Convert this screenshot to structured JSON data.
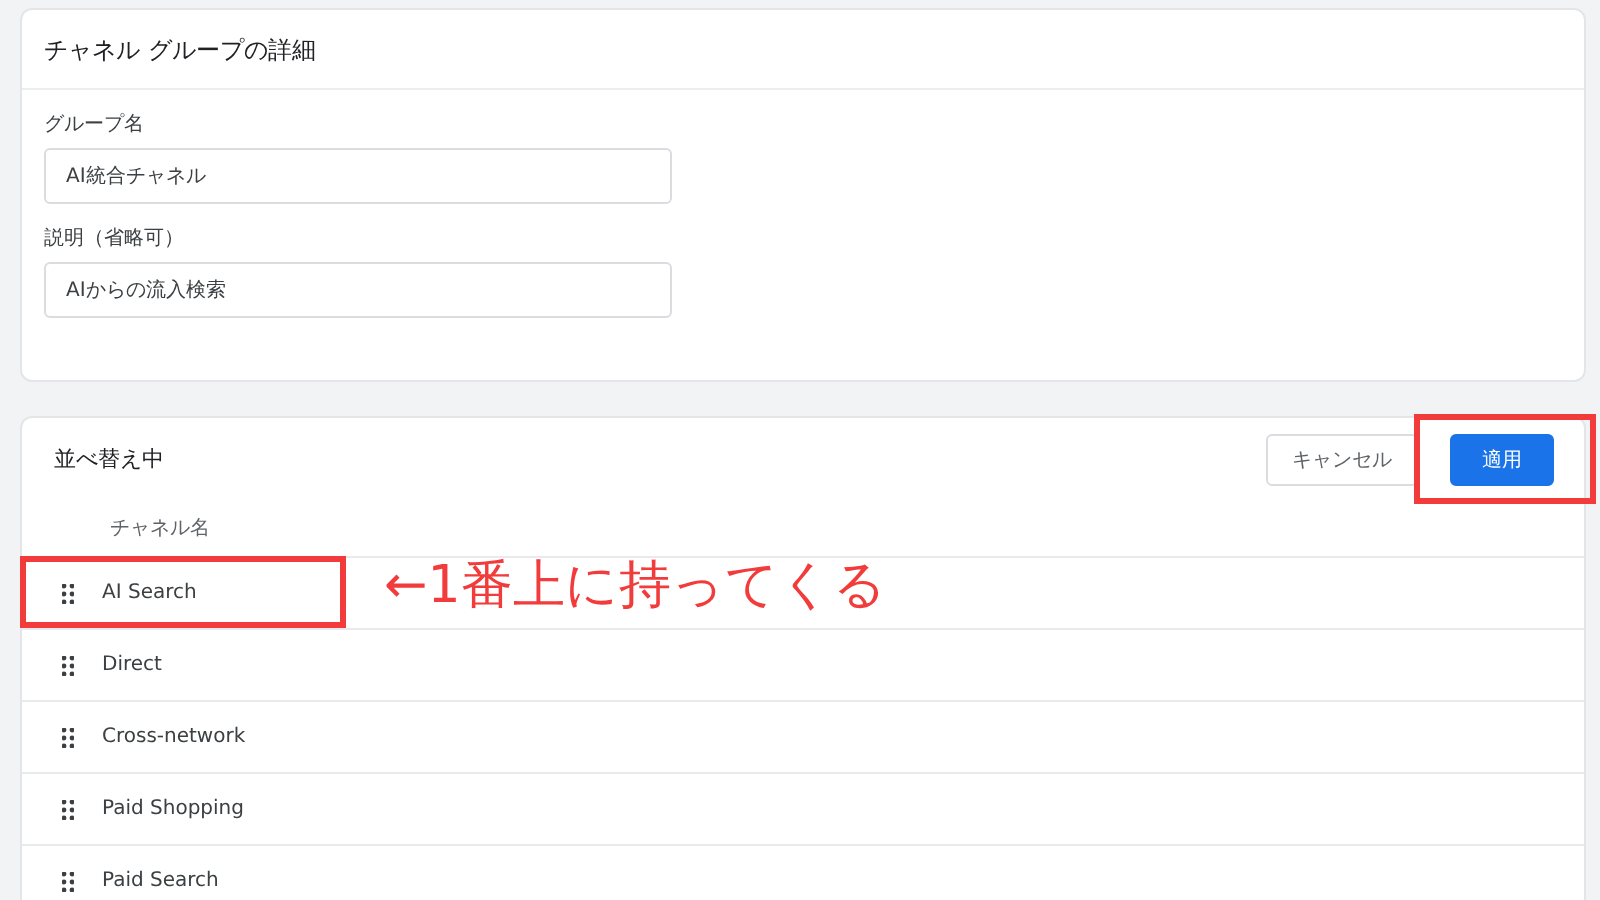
{
  "details_card": {
    "title": "チャネル グループの詳細",
    "fields": [
      {
        "label": "グループ名",
        "value": "AI統合チャネル"
      },
      {
        "label": "説明（省略可）",
        "value": "AIからの流入検索"
      }
    ]
  },
  "reorder_card": {
    "title": "並べ替え中",
    "buttons": [
      {
        "label": "キャンセル",
        "kind": "secondary"
      },
      {
        "label": "適用",
        "kind": "primary"
      }
    ],
    "column_header": "チャネル名",
    "rows": [
      {
        "name": "AI Search"
      },
      {
        "name": "Direct"
      },
      {
        "name": "Cross-network"
      },
      {
        "name": "Paid Shopping"
      },
      {
        "name": "Paid Search"
      }
    ]
  },
  "annotations": {
    "note": "←1番上に持ってくる"
  }
}
